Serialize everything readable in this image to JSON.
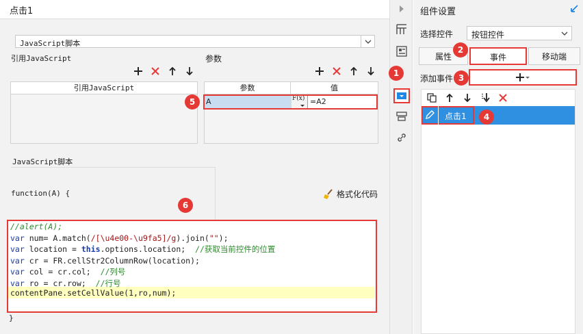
{
  "title": "点击1",
  "script_type": "JavaScript脚本",
  "ref_js": {
    "label": "引用JavaScript",
    "column": "引用JavaScript"
  },
  "params": {
    "label": "参数",
    "col_param": "参数",
    "col_value": "值",
    "row_param": "A",
    "row_fx": "F(x)",
    "row_value": "=A2"
  },
  "script_section_label": "JavaScript脚本",
  "function_sig": "function(A) {",
  "format_code": "格式化代码",
  "code_lines": {
    "l1": "//alert(A);",
    "l2a": "var",
    "l2b": " num= A.match(",
    "l2c": "/[\\u4e00-\\u9fa5]/g",
    "l2d": ").join(",
    "l2e": "\"\"",
    "l2f": ");",
    "l3a": "var",
    "l3b": " location = ",
    "l3c": "this",
    "l3d": ".options.location;  ",
    "l3e": "//获取当前控件的位置",
    "l4a": "var",
    "l4b": " cr = FR.cellStr2ColumnRow(location);",
    "l5a": "var",
    "l5b": " col = cr.col;  ",
    "l5c": "//列号",
    "l6a": "var",
    "l6b": " ro = cr.row;  ",
    "l6c": "//行号",
    "l7": "contentPane.setCellValue(1,ro,num);"
  },
  "closing_brace": "}",
  "right": {
    "title": "组件设置",
    "select_label": "选择控件",
    "select_value": "按钮控件",
    "tabs": [
      "属性",
      "事件",
      "移动端"
    ],
    "add_event_label": "添加事件",
    "event_item": "点击1"
  },
  "badges": [
    "1",
    "2",
    "3",
    "4",
    "5",
    "6"
  ],
  "colors": {
    "accent": "#1e88e5",
    "highlight": "#e53935",
    "event_bg": "#2f8fe0",
    "code_highlight": "#ffffc0"
  },
  "icons": [
    "plus-icon",
    "delete-icon",
    "arrow-up-icon",
    "arrow-down-icon",
    "broom-icon",
    "copy-icon",
    "edit-icon"
  ]
}
